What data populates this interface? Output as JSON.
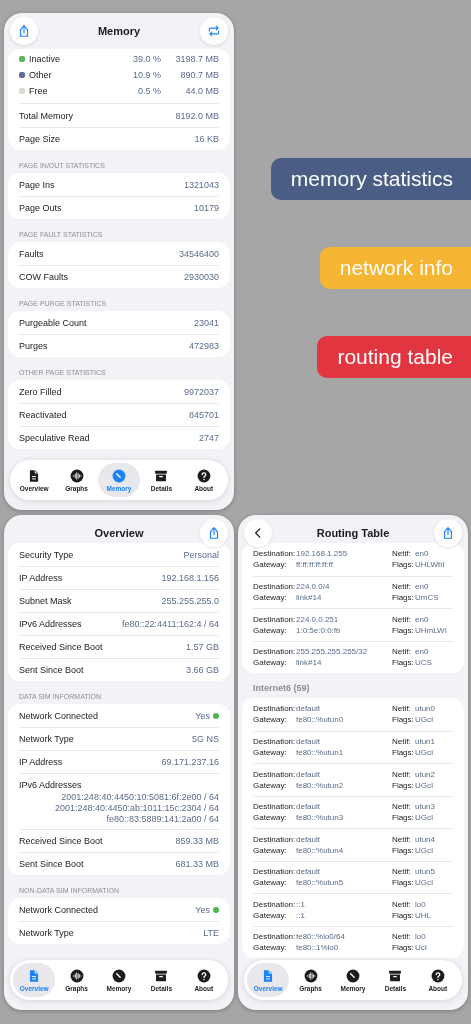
{
  "banners": [
    {
      "text": "memory statistics",
      "color": "#4a5d85"
    },
    {
      "text": "network info",
      "color": "#f6b532"
    },
    {
      "text": "routing table",
      "color": "#e1353f"
    }
  ],
  "memory_screen": {
    "title": "Memory",
    "breakdown": [
      {
        "name": "Inactive",
        "color": "#5cb85c",
        "percent": "39.0 %",
        "size": "3198.7 MB"
      },
      {
        "name": "Other",
        "color": "#5a6f92",
        "percent": "10.9 %",
        "size": "890.7 MB"
      },
      {
        "name": "Free",
        "color": "#d8d8cf",
        "percent": "0.5 %",
        "size": "44.0 MB"
      }
    ],
    "totals": [
      {
        "label": "Total Memory",
        "value": "8192.0 MB"
      },
      {
        "label": "Page Size",
        "value": "16 KB"
      }
    ],
    "sections": [
      {
        "header": "PAGE IN/OUT STATISTICS",
        "rows": [
          {
            "label": "Page Ins",
            "value": "1321043"
          },
          {
            "label": "Page Outs",
            "value": "10179"
          }
        ]
      },
      {
        "header": "PAGE FAULT STATISTICS",
        "rows": [
          {
            "label": "Faults",
            "value": "34546400"
          },
          {
            "label": "COW Faults",
            "value": "2930030"
          }
        ]
      },
      {
        "header": "PAGE PURGE STATISTICS",
        "rows": [
          {
            "label": "Purgeable Count",
            "value": "23041"
          },
          {
            "label": "Purges",
            "value": "472983"
          }
        ]
      },
      {
        "header": "OTHER PAGE STATISTICS",
        "rows": [
          {
            "label": "Zero Filled",
            "value": "9972037"
          },
          {
            "label": "Reactivated",
            "value": "845701"
          },
          {
            "label": "Speculative Read",
            "value": "2747"
          }
        ]
      }
    ],
    "tabs": [
      {
        "label": "Overview",
        "selected": false
      },
      {
        "label": "Graphs",
        "selected": false
      },
      {
        "label": "Memory",
        "selected": true
      },
      {
        "label": "Details",
        "selected": false
      },
      {
        "label": "About",
        "selected": false
      }
    ]
  },
  "overview_screen": {
    "title": "Overview",
    "sections": [
      {
        "rows": [
          {
            "kind": "text",
            "label": "Security Type",
            "value": "Personal"
          },
          {
            "kind": "text",
            "label": "IP Address",
            "value": "192.168.1.156"
          },
          {
            "kind": "text",
            "label": "Subnet Mask",
            "value": "255.255.255.0"
          },
          {
            "kind": "text",
            "label": "IPv6 Addresses",
            "value": "fe80::22:4411:162:4 / 64"
          },
          {
            "kind": "text",
            "label": "Received Since Boot",
            "value": "1.57 GB"
          },
          {
            "kind": "text",
            "label": "Sent Since Boot",
            "value": "3.66 GB"
          }
        ]
      },
      {
        "header": "DATA SIM INFORMATION",
        "rows": [
          {
            "kind": "status",
            "label": "Network Connected",
            "value": "Yes"
          },
          {
            "kind": "text",
            "label": "Network Type",
            "value": "5G NS"
          },
          {
            "kind": "text",
            "label": "IP Address",
            "value": "69.171.237.16"
          },
          {
            "kind": "multiline",
            "label": "IPv6 Addresses",
            "values": [
              "2001:248:40:4450:10:5081:6f:2e00 / 64",
              "2001:248:40:4450:ab:1011:15c:2304 / 64",
              "fe80::83:5889:141:2a00 / 64"
            ]
          },
          {
            "kind": "text",
            "label": "Received Since Boot",
            "value": "859.33 MB"
          },
          {
            "kind": "text",
            "label": "Sent Since Boot",
            "value": "681.33 MB"
          }
        ]
      },
      {
        "header": "NON-DATA SIM INFORMATION",
        "rows": [
          {
            "kind": "status",
            "label": "Network Connected",
            "value": "Yes"
          },
          {
            "kind": "text",
            "label": "Network Type",
            "value": "LTE"
          }
        ]
      }
    ],
    "tabs": [
      {
        "label": "Overview",
        "selected": true
      },
      {
        "label": "Graphs",
        "selected": false
      },
      {
        "label": "Memory",
        "selected": false
      },
      {
        "label": "Details",
        "selected": false
      },
      {
        "label": "About",
        "selected": false
      }
    ]
  },
  "routing_screen": {
    "title": "Routing Table",
    "groups": [
      {
        "routes": [
          {
            "dest_label": "Destination:",
            "dest": "192.168.1.255",
            "gw_label": "Gateway:",
            "gw": "ff:ff:ff:ff:ff:ff",
            "netif_label": "Netif:",
            "netif": "en0",
            "flags_label": "Flags:",
            "flags": "UHLWbI"
          },
          {
            "dest_label": "Destination:",
            "dest": "224.0.0/4",
            "gw_label": "Gateway:",
            "gw": "link#14",
            "netif_label": "Netif:",
            "netif": "en0",
            "flags_label": "Flags:",
            "flags": "UmCS"
          },
          {
            "dest_label": "Destination:",
            "dest": "224.0.0.251",
            "gw_label": "Gateway:",
            "gw": "1:0:5e:0:0:fb",
            "netif_label": "Netif:",
            "netif": "en0",
            "flags_label": "Flags:",
            "flags": "UHmLWI"
          },
          {
            "dest_label": "Destination:",
            "dest": "255.255.255.255/32",
            "gw_label": "Gateway:",
            "gw": "link#14",
            "netif_label": "Netif:",
            "netif": "en0",
            "flags_label": "Flags:",
            "flags": "UCS"
          }
        ]
      },
      {
        "header": "Internet6 (59)",
        "routes": [
          {
            "dest_label": "Destination:",
            "dest": "default",
            "gw_label": "Gateway:",
            "gw": "fe80::%utun0",
            "netif_label": "Netif:",
            "netif": "utun0",
            "flags_label": "Flags:",
            "flags": "UGcI"
          },
          {
            "dest_label": "Destination:",
            "dest": "default",
            "gw_label": "Gateway:",
            "gw": "fe80::%utun1",
            "netif_label": "Netif:",
            "netif": "utun1",
            "flags_label": "Flags:",
            "flags": "UGcI"
          },
          {
            "dest_label": "Destination:",
            "dest": "default",
            "gw_label": "Gateway:",
            "gw": "fe80::%utun2",
            "netif_label": "Netif:",
            "netif": "utun2",
            "flags_label": "Flags:",
            "flags": "UGcI"
          },
          {
            "dest_label": "Destination:",
            "dest": "default",
            "gw_label": "Gateway:",
            "gw": "fe80::%utun3",
            "netif_label": "Netif:",
            "netif": "utun3",
            "flags_label": "Flags:",
            "flags": "UGcI"
          },
          {
            "dest_label": "Destination:",
            "dest": "default",
            "gw_label": "Gateway:",
            "gw": "fe80::%utun4",
            "netif_label": "Netif:",
            "netif": "utun4",
            "flags_label": "Flags:",
            "flags": "UGcI"
          },
          {
            "dest_label": "Destination:",
            "dest": "default",
            "gw_label": "Gateway:",
            "gw": "fe80::%utun5",
            "netif_label": "Netif:",
            "netif": "utun5",
            "flags_label": "Flags:",
            "flags": "UGcI"
          },
          {
            "dest_label": "Destination:",
            "dest": "::1",
            "gw_label": "Gateway:",
            "gw": "::1",
            "netif_label": "Netif:",
            "netif": "lo0",
            "flags_label": "Flags:",
            "flags": "UHL"
          },
          {
            "dest_label": "Destination:",
            "dest": "fe80::%lo0/64",
            "gw_label": "Gateway:",
            "gw": "fe80::1%lo0",
            "netif_label": "Netif:",
            "netif": "lo0",
            "flags_label": "Flags:",
            "flags": "UcI"
          }
        ]
      }
    ],
    "tabs": [
      {
        "label": "Overview",
        "selected": true
      },
      {
        "label": "Graphs",
        "selected": false
      },
      {
        "label": "Memory",
        "selected": false
      },
      {
        "label": "Details",
        "selected": false
      },
      {
        "label": "About",
        "selected": false
      }
    ]
  }
}
